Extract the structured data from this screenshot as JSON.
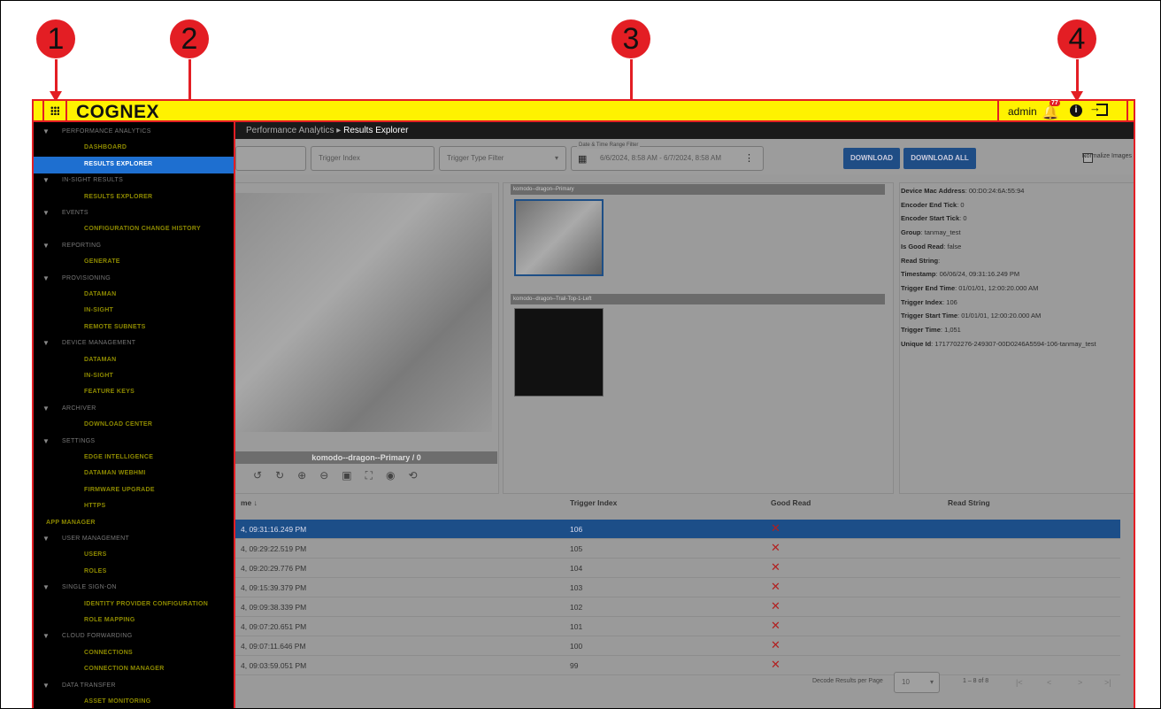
{
  "callouts": [
    "1",
    "2",
    "3",
    "4"
  ],
  "header": {
    "logo": "COGNEX",
    "user": "admin",
    "notification_count": "77",
    "icons": [
      "app-grid-icon",
      "bell-icon",
      "info-icon",
      "logout-icon"
    ]
  },
  "breadcrumb": {
    "parent": "Performance Analytics",
    "separator": "▸",
    "current": "Results Explorer"
  },
  "filters": {
    "trigger_index": "Trigger Index",
    "trigger_type": "Trigger Type Filter",
    "date_range_label": "Date & Time Range Filter",
    "date_range_value": "6/6/2024, 8:58 AM - 6/7/2024, 8:58 AM",
    "download": "DOWNLOAD",
    "download_all": "DOWNLOAD ALL",
    "normalize": "Normalize Images"
  },
  "viewer": {
    "caption": "komodo--dragon--Primary / 0",
    "tools": [
      "rotate-ccw-icon",
      "rotate-cw-icon",
      "zoom-in-icon",
      "zoom-out-icon",
      "fit-icon",
      "fullscreen-icon",
      "focus-icon",
      "reset-icon"
    ]
  },
  "thumbnails": [
    {
      "title": "komodo--dragon--Primary"
    },
    {
      "title": "komodo--dragon--Trail-Top-1-Left"
    }
  ],
  "metadata": [
    {
      "key": "Device Mac Address",
      "value": "00:D0:24:6A:55:94"
    },
    {
      "key": "Encoder End Tick",
      "value": "0"
    },
    {
      "key": "Encoder Start Tick",
      "value": "0"
    },
    {
      "key": "Group",
      "value": "tanmay_test"
    },
    {
      "key": "Is Good Read",
      "value": "false"
    },
    {
      "key": "Read String",
      "value": ""
    },
    {
      "key": "Timestamp",
      "value": "06/06/24, 09:31:16.249 PM"
    },
    {
      "key": "Trigger End Time",
      "value": "01/01/01, 12:00:20.000 AM"
    },
    {
      "key": "Trigger Index",
      "value": "106"
    },
    {
      "key": "Trigger Start Time",
      "value": "01/01/01, 12:00:20.000 AM"
    },
    {
      "key": "Trigger Time",
      "value": "1,051"
    },
    {
      "key": "Unique Id",
      "value": "1717702276-249307-00D0246A5594-106-tanmay_test"
    }
  ],
  "table": {
    "headers": [
      "me ↓",
      "Trigger Index",
      "Good Read",
      "Read String"
    ],
    "rows": [
      {
        "time": "4, 09:31:16.249 PM",
        "index": "106",
        "good": "✕"
      },
      {
        "time": "4, 09:29:22.519 PM",
        "index": "105",
        "good": "✕"
      },
      {
        "time": "4, 09:20:29.776 PM",
        "index": "104",
        "good": "✕"
      },
      {
        "time": "4, 09:15:39.379 PM",
        "index": "103",
        "good": "✕"
      },
      {
        "time": "4, 09:09:38.339 PM",
        "index": "102",
        "good": "✕"
      },
      {
        "time": "4, 09:07:20.651 PM",
        "index": "101",
        "good": "✕"
      },
      {
        "time": "4, 09:07:11.646 PM",
        "index": "100",
        "good": "✕"
      },
      {
        "time": "4, 09:03:59.051 PM",
        "index": "99",
        "good": "✕"
      }
    ]
  },
  "pager": {
    "label": "Decode Results per Page",
    "per_page": "10",
    "range": "1 – 8 of 8"
  },
  "sidebar": {
    "nav": [
      {
        "kind": "section",
        "label": "PERFORMANCE ANALYTICS"
      },
      {
        "kind": "item",
        "label": "DASHBOARD"
      },
      {
        "kind": "item",
        "label": "RESULTS EXPLORER",
        "active": true
      },
      {
        "kind": "section",
        "label": "IN-SIGHT RESULTS"
      },
      {
        "kind": "item",
        "label": "RESULTS EXPLORER"
      },
      {
        "kind": "section",
        "label": "EVENTS"
      },
      {
        "kind": "item",
        "label": "CONFIGURATION CHANGE HISTORY"
      },
      {
        "kind": "section",
        "label": "REPORTING"
      },
      {
        "kind": "item",
        "label": "GENERATE"
      },
      {
        "kind": "section",
        "label": "PROVISIONING"
      },
      {
        "kind": "item",
        "label": "DATAMAN"
      },
      {
        "kind": "item",
        "label": "IN-SIGHT"
      },
      {
        "kind": "item",
        "label": "REMOTE SUBNETS"
      },
      {
        "kind": "section",
        "label": "DEVICE MANAGEMENT"
      },
      {
        "kind": "item",
        "label": "DATAMAN"
      },
      {
        "kind": "item",
        "label": "IN-SIGHT"
      },
      {
        "kind": "item",
        "label": "FEATURE KEYS"
      },
      {
        "kind": "section",
        "label": "ARCHIVER"
      },
      {
        "kind": "item",
        "label": "DOWNLOAD CENTER"
      },
      {
        "kind": "section",
        "label": "SETTINGS"
      },
      {
        "kind": "item",
        "label": "EDGE INTELLIGENCE"
      },
      {
        "kind": "item",
        "label": "DATAMAN WEBHMI"
      },
      {
        "kind": "item",
        "label": "FIRMWARE UPGRADE"
      },
      {
        "kind": "item",
        "label": "HTTPS"
      },
      {
        "kind": "top",
        "label": "APP MANAGER"
      },
      {
        "kind": "section",
        "label": "USER MANAGEMENT"
      },
      {
        "kind": "item",
        "label": "USERS"
      },
      {
        "kind": "item",
        "label": "ROLES"
      },
      {
        "kind": "section",
        "label": "SINGLE SIGN-ON"
      },
      {
        "kind": "item",
        "label": "IDENTITY PROVIDER CONFIGURATION"
      },
      {
        "kind": "item",
        "label": "ROLE MAPPING"
      },
      {
        "kind": "section",
        "label": "CLOUD FORWARDING"
      },
      {
        "kind": "item",
        "label": "CONNECTIONS"
      },
      {
        "kind": "item",
        "label": "CONNECTION MANAGER"
      },
      {
        "kind": "section",
        "label": "DATA TRANSFER"
      },
      {
        "kind": "item",
        "label": "ASSET MONITORING"
      }
    ]
  }
}
